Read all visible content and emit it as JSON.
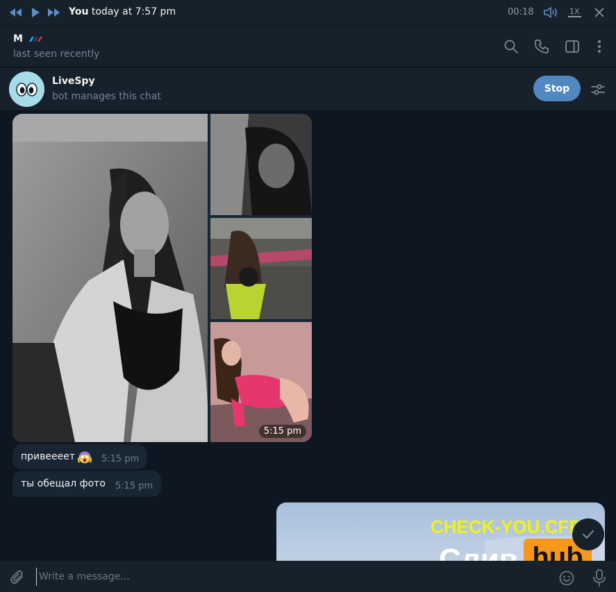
{
  "player": {
    "title_name": "You",
    "title_rest": " today at 7:57 pm",
    "time": "00:18",
    "speed": "1X",
    "icons": [
      "rewind-icon",
      "play-icon",
      "fast-forward-icon",
      "volume-icon",
      "close-icon"
    ]
  },
  "header": {
    "name": "M",
    "status": "last seen recently",
    "icons": [
      "search-icon",
      "phone-icon",
      "sidebar-icon",
      "more-icon"
    ]
  },
  "bot": {
    "name": "LiveSpy",
    "subtitle": "bot manages this chat",
    "stop_label": "Stop",
    "icons": [
      "settings-sliders-icon"
    ]
  },
  "messages": {
    "album_time": "5:15 pm",
    "incoming": [
      {
        "text": "привеееет",
        "time": "5:15 pm",
        "emoji": "screaming-face-emoji"
      },
      {
        "text": "ты обещал фото",
        "time": "5:15 pm"
      }
    ],
    "outgoing_photo_watermark": {
      "line1": "CHECK-YOU.CFD",
      "line2": "Слив",
      "badge": "hub"
    }
  },
  "composer": {
    "placeholder": "Write a message...",
    "icons": [
      "attach-icon",
      "emoji-icon",
      "microphone-icon"
    ]
  },
  "colors": {
    "background": "#0e1621",
    "panel": "#17212b",
    "bubble_in": "#182533",
    "accent": "#5288c1",
    "muted": "#708499"
  }
}
